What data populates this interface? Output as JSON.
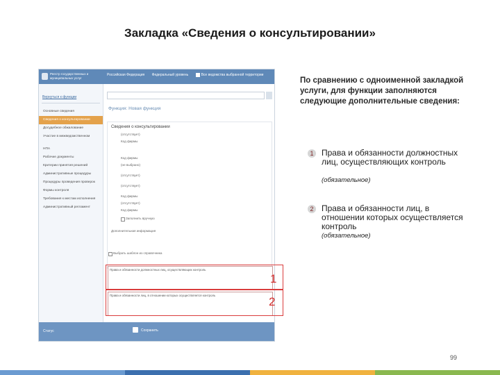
{
  "title": "Закладка «Сведения о консультировании»",
  "screenshot": {
    "logo_text": "Реестр государственных и муниципальных услуг",
    "top_links": [
      "Российская Федерация",
      "Федеральный уровень",
      "Все ведомства выбранной территории"
    ],
    "back_link": "Вернуться к функции",
    "sidebar_items": [
      "Основные сведения",
      "Сведения о консультировании",
      "Досудебное обжалование",
      "Участие в межведомственном",
      "НПА",
      "Рабочие документы",
      "Критерии принятия решений",
      "Административные процедуры",
      "Процедуры проведения проверок",
      "Формы контроля",
      "Требования к местам исполнения",
      "Административный регламент"
    ],
    "function_title": "Функция: Новая функция",
    "section_title": "Сведения о консультировании",
    "form_labels": [
      "(отсутствует)",
      "Код фирмы",
      "Код фирмы",
      "(не выбрано)",
      "(отсутствует)",
      "(отсутствует)",
      "Код фирмы",
      "(отсутствует)",
      "Код фирмы"
    ],
    "checkbox_label": "Заполнить вручную",
    "extra_label": "Дополнительная информация",
    "footer_checkbox": "Выбрать шаблон из справочника",
    "field1_label": "Права и обязанности должностных лиц, осуществляющих контроль",
    "field2_label": "Права и обязанности лиц, в отношении которых осуществляется контроль",
    "footer_left": "Статус",
    "footer_center": "Сохранить",
    "marker1": "1",
    "marker2": "2"
  },
  "panel": {
    "intro": "По сравнению с одноименной закладкой услуги, для функции заполняются следующие дополнительные сведения:",
    "items": [
      {
        "num": "1",
        "text": "Права и обязанности должностных лиц, осуществляющих контроль",
        "note": "(обязательное)"
      },
      {
        "num": "2",
        "text": "Права и обязанности лиц, в отношении которых осуществляется контроль",
        "note": "(обязательное)"
      }
    ]
  },
  "page_number": "99",
  "colors": {
    "accent_orange": "#e4a24b",
    "blue": "#5f89b8",
    "red": "#d93b3b",
    "bar": [
      "#6b9bd1",
      "#3c6fae",
      "#f0b23f",
      "#8ab84f"
    ]
  }
}
